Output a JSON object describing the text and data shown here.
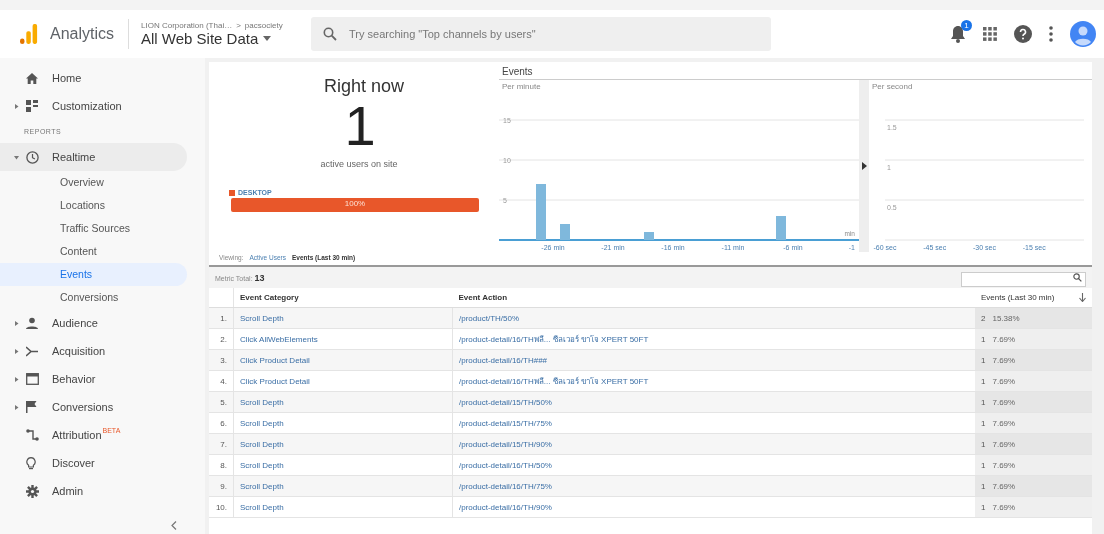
{
  "header": {
    "product": "Analytics",
    "breadcrumb": "LION Corporation (Thai…",
    "breadcrumb_sep": ">",
    "property": "pacsociety",
    "view": "All Web Site Data",
    "search": {
      "placeholder": "Try searching \"Top channels by users\""
    },
    "notification_count": "1"
  },
  "sidebar": {
    "items": [
      {
        "kind": "item",
        "label": "Home",
        "expandable": false,
        "expanded": false,
        "selected": false
      },
      {
        "kind": "item",
        "label": "Customization",
        "expandable": true,
        "expanded": false,
        "selected": false
      },
      {
        "kind": "heading",
        "label": "REPORTS"
      },
      {
        "kind": "item",
        "label": "Realtime",
        "expandable": true,
        "expanded": true,
        "selected": false,
        "children": [
          {
            "label": "Overview",
            "selected": false
          },
          {
            "label": "Locations",
            "selected": false
          },
          {
            "label": "Traffic Sources",
            "selected": false
          },
          {
            "label": "Content",
            "selected": false
          },
          {
            "label": "Events",
            "selected": true
          },
          {
            "label": "Conversions",
            "selected": false
          }
        ]
      },
      {
        "kind": "item",
        "label": "Audience",
        "expandable": true,
        "expanded": false,
        "selected": false
      },
      {
        "kind": "item",
        "label": "Acquisition",
        "expandable": true,
        "expanded": false,
        "selected": false
      },
      {
        "kind": "item",
        "label": "Behavior",
        "expandable": true,
        "expanded": false,
        "selected": false
      },
      {
        "kind": "item",
        "label": "Conversions",
        "expandable": true,
        "expanded": false,
        "selected": false
      },
      {
        "kind": "item",
        "label": "Attribution",
        "badge": "BETA",
        "expandable": false,
        "expanded": false,
        "selected": false
      },
      {
        "kind": "item",
        "label": "Discover",
        "expandable": false,
        "expanded": false,
        "selected": false
      },
      {
        "kind": "item",
        "label": "Admin",
        "expandable": false,
        "expanded": false,
        "selected": false
      }
    ]
  },
  "right_now": {
    "title": "Right now",
    "count": "1",
    "caption": "active users on site",
    "devices": [
      {
        "label": "DESKTOP",
        "share": "100%",
        "level": 1,
        "color": "#e8572a"
      }
    ]
  },
  "events_chart": {
    "title": "Events",
    "per_minute": {
      "subtitle": "Per minute",
      "unit_label": "min",
      "end_label": "-1",
      "chart_data": {
        "type": "bar",
        "x": [
          -27,
          -25,
          -18,
          -7
        ],
        "series": [
          {
            "color": "#7fb8dc",
            "values": [
              7,
              2,
              1,
              3
            ]
          }
        ],
        "xlim": [
          -30.5,
          -0.5
        ],
        "ylim": [
          0,
          15
        ],
        "yticks": [
          5,
          10,
          15
        ],
        "xticks": [
          {
            "value": -26,
            "label": "-26 min"
          },
          {
            "value": -21,
            "label": "-21 min"
          },
          {
            "value": -16,
            "label": "-16 min"
          },
          {
            "value": -11,
            "label": "-11 min"
          },
          {
            "value": -6,
            "label": "-6 min"
          }
        ]
      }
    },
    "per_second": {
      "subtitle": "Per second",
      "chart_data": {
        "type": "bar",
        "xlim": [
          -60,
          0
        ],
        "ylim": [
          0,
          1.5
        ],
        "yticks": [
          0.5,
          1,
          1.5
        ],
        "xticks": [
          {
            "value": -60,
            "label": "-60 sec"
          },
          {
            "value": -45,
            "label": "-45 sec"
          },
          {
            "value": -30,
            "label": "-30 sec"
          },
          {
            "value": -15,
            "label": "-15 sec"
          }
        ]
      }
    }
  },
  "viewing": {
    "label": "Viewing:",
    "tabs": [
      {
        "label": "Active Users",
        "selected": false
      },
      {
        "label": "Events (Last 30 min)",
        "selected": true
      }
    ]
  },
  "table": {
    "metric_total_label": "Metric Total:",
    "metric_total": "13",
    "columns": [
      {
        "label": "Event Category"
      },
      {
        "label": "Event Action"
      },
      {
        "label": "Events (Last 30 min)",
        "sorted": true
      }
    ],
    "rows": [
      {
        "index": "1.",
        "category": "Scroll Depth",
        "action": "/product/TH/50%",
        "count": "2",
        "percent": "15.38%"
      },
      {
        "index": "2.",
        "category": "Click AllWebElements",
        "action": "/product-detail/16/THพลี... ซีลเวอร์ ขาโจ XPERT 50FT",
        "count": "1",
        "percent": "7.69%"
      },
      {
        "index": "3.",
        "category": "Click Product Detail",
        "action": "/product-detail/16/TH###",
        "count": "1",
        "percent": "7.69%"
      },
      {
        "index": "4.",
        "category": "Click Product Detail",
        "action": "/product-detail/16/THพลี... ซีลเวอร์ ขาโจ XPERT 50FT",
        "count": "1",
        "percent": "7.69%"
      },
      {
        "index": "5.",
        "category": "Scroll Depth",
        "action": "/product-detail/15/TH/50%",
        "count": "1",
        "percent": "7.69%"
      },
      {
        "index": "6.",
        "category": "Scroll Depth",
        "action": "/product-detail/15/TH/75%",
        "count": "1",
        "percent": "7.69%"
      },
      {
        "index": "7.",
        "category": "Scroll Depth",
        "action": "/product-detail/15/TH/90%",
        "count": "1",
        "percent": "7.69%"
      },
      {
        "index": "8.",
        "category": "Scroll Depth",
        "action": "/product-detail/16/TH/50%",
        "count": "1",
        "percent": "7.69%"
      },
      {
        "index": "9.",
        "category": "Scroll Depth",
        "action": "/product-detail/16/TH/75%",
        "count": "1",
        "percent": "7.69%"
      },
      {
        "index": "10.",
        "category": "Scroll Depth",
        "action": "/product-detail/16/TH/90%",
        "count": "1",
        "percent": "7.69%"
      }
    ]
  }
}
